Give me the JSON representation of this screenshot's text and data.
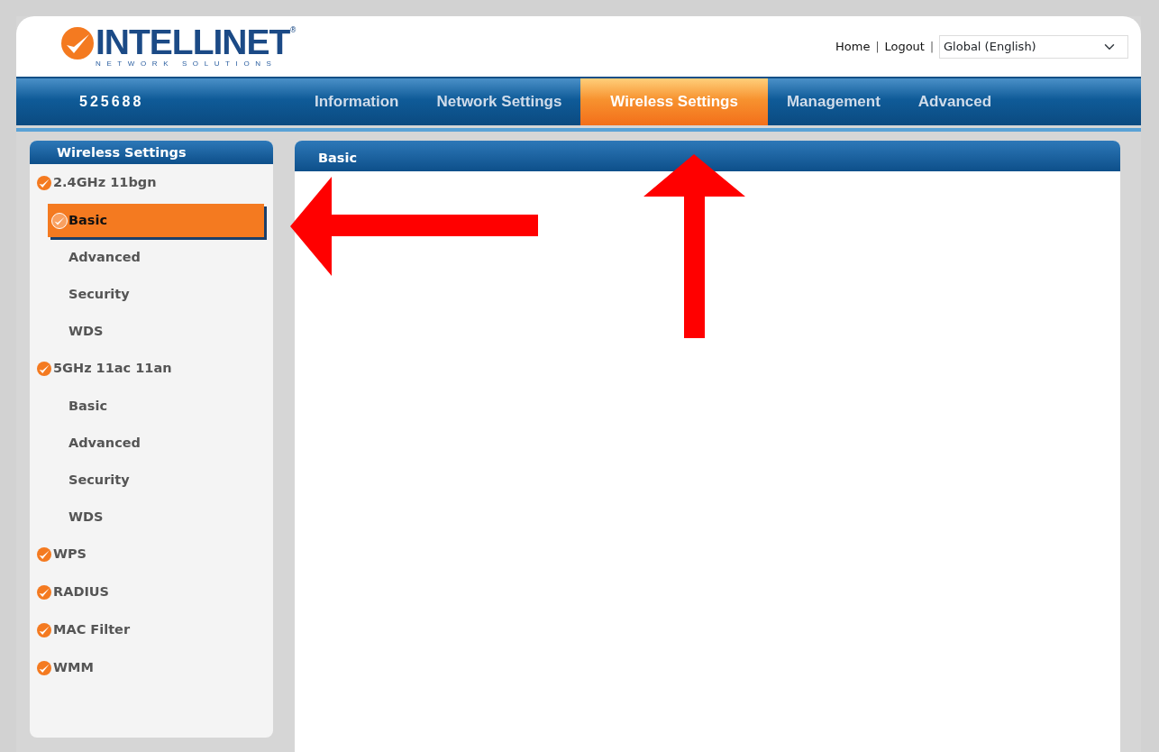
{
  "logo": {
    "name": "INTELLINET",
    "registered": "®",
    "tagline": "NETWORK SOLUTIONS"
  },
  "header_links": [
    {
      "kind": "link",
      "text": "Home"
    },
    {
      "kind": "separator",
      "text": "|"
    },
    {
      "kind": "link",
      "text": "Logout"
    },
    {
      "kind": "separator",
      "text": "|"
    }
  ],
  "language_select": {
    "value": "Global (English)"
  },
  "device_name": "525688",
  "tabs": [
    {
      "label": "Information",
      "selected": false
    },
    {
      "label": "Network Settings",
      "selected": false
    },
    {
      "label": "Wireless Settings",
      "selected": true
    },
    {
      "label": "Management",
      "selected": false
    },
    {
      "label": "Advanced",
      "selected": false
    }
  ],
  "sidebar": {
    "title": "Wireless Settings",
    "items": [
      {
        "label": "2.4GHz 11bgn",
        "selected": false,
        "children": [
          {
            "label": "Basic",
            "selected": true
          },
          {
            "label": "Advanced",
            "selected": false
          },
          {
            "label": "Security",
            "selected": false
          },
          {
            "label": "WDS",
            "selected": false
          }
        ]
      },
      {
        "label": "5GHz 11ac 11an",
        "selected": false,
        "children": [
          {
            "label": "Basic",
            "selected": false
          },
          {
            "label": "Advanced",
            "selected": false
          },
          {
            "label": "Security",
            "selected": false
          },
          {
            "label": "WDS",
            "selected": false
          }
        ]
      },
      {
        "label": "WPS",
        "selected": false
      },
      {
        "label": "RADIUS",
        "selected": false
      },
      {
        "label": "MAC Filter",
        "selected": false
      },
      {
        "label": "WMM",
        "selected": false
      }
    ]
  },
  "panel": {
    "title": "Basic"
  }
}
